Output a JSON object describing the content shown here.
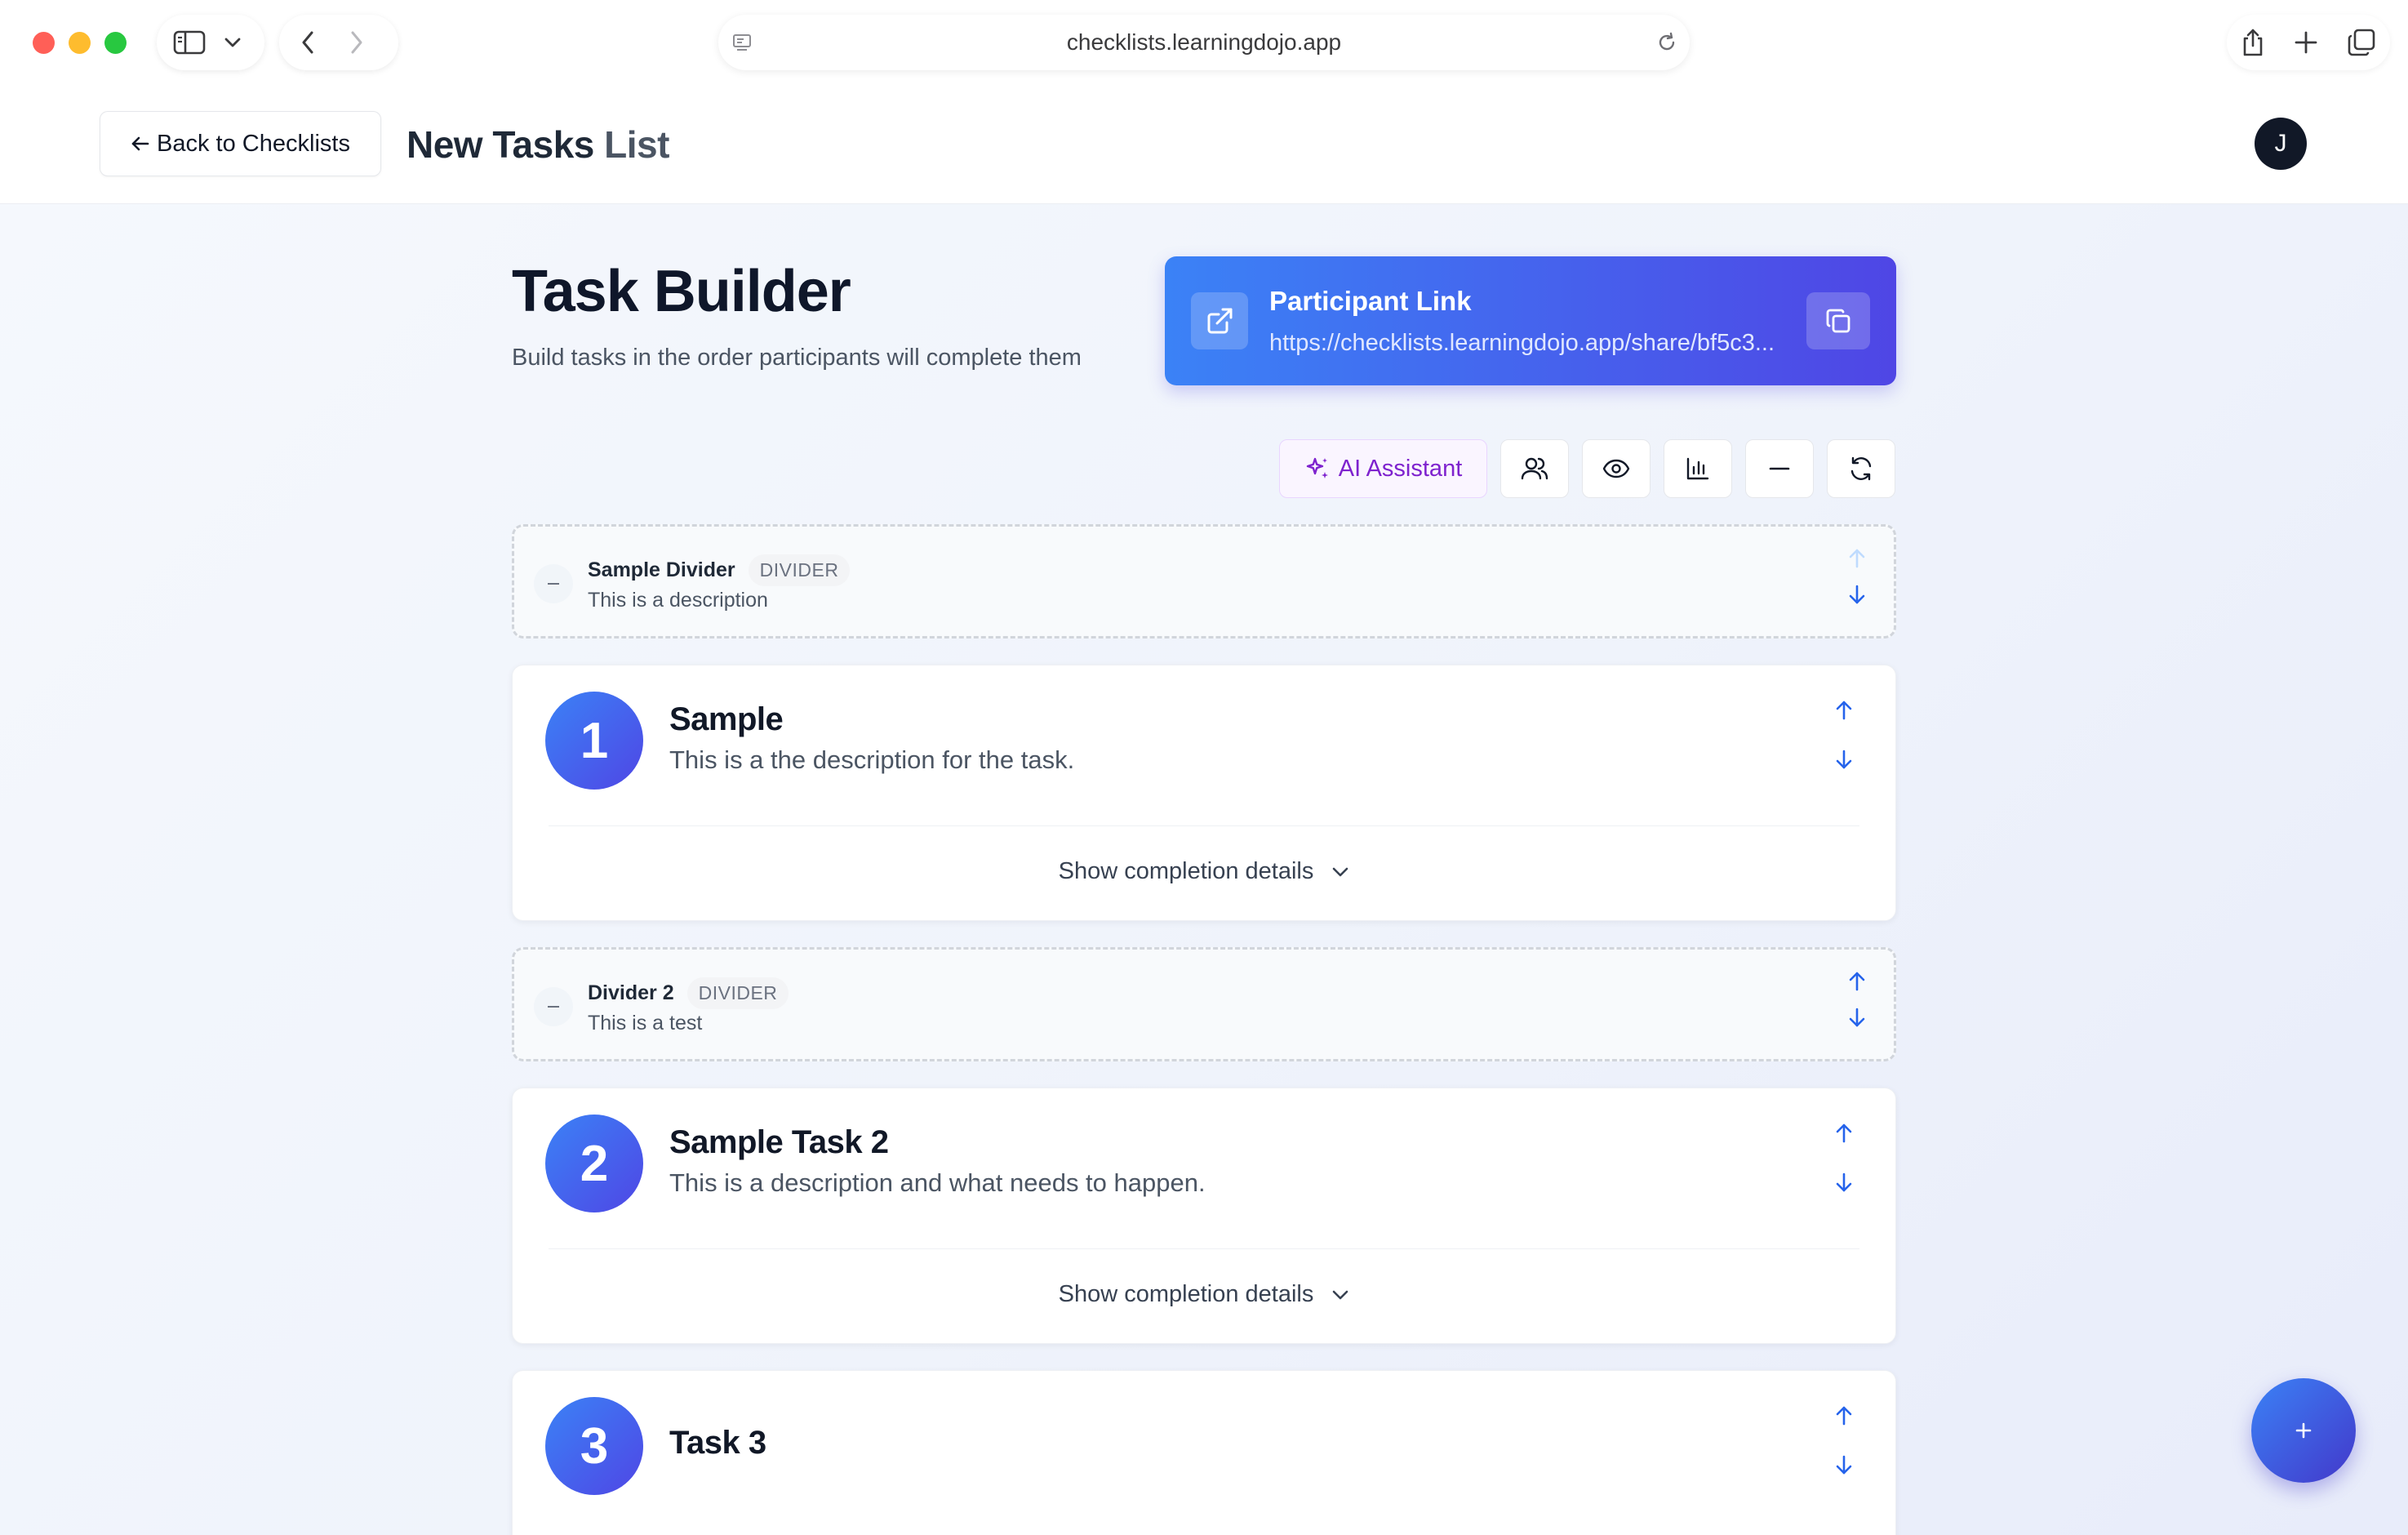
{
  "browser": {
    "url": "checklists.learningdojo.app"
  },
  "header": {
    "back_label": "Back to Checklists",
    "list_title_main": "New Tasks",
    "list_title_faded": " List",
    "avatar_initial": "J"
  },
  "builder": {
    "title": "Task Builder",
    "subtitle": "Build tasks in the order participants will complete them"
  },
  "participant_link": {
    "label": "Participant Link",
    "url": "https://checklists.learningdojo.app/share/bf5c3..."
  },
  "toolbar": {
    "ai_label": "AI Assistant",
    "icons": [
      "users-icon",
      "eye-icon",
      "bar-chart-icon",
      "minus-icon",
      "refresh-icon"
    ]
  },
  "items": [
    {
      "kind": "divider",
      "title": "Sample Divider",
      "badge": "DIVIDER",
      "description": "This is a description"
    },
    {
      "kind": "task",
      "number": "1",
      "title": "Sample",
      "description": "This is a the description for the task.",
      "details_label": "Show completion details"
    },
    {
      "kind": "divider",
      "title": "Divider 2",
      "badge": "DIVIDER",
      "description": "This is a test"
    },
    {
      "kind": "task",
      "number": "2",
      "title": "Sample Task 2",
      "description": "This is a description and what needs to happen.",
      "details_label": "Show completion details"
    },
    {
      "kind": "task",
      "number": "3",
      "title": "Task 3",
      "description": ""
    }
  ],
  "colors": {
    "accent_start": "#3b82f6",
    "accent_end": "#4f46e5",
    "ai_purple": "#7e22ce"
  }
}
